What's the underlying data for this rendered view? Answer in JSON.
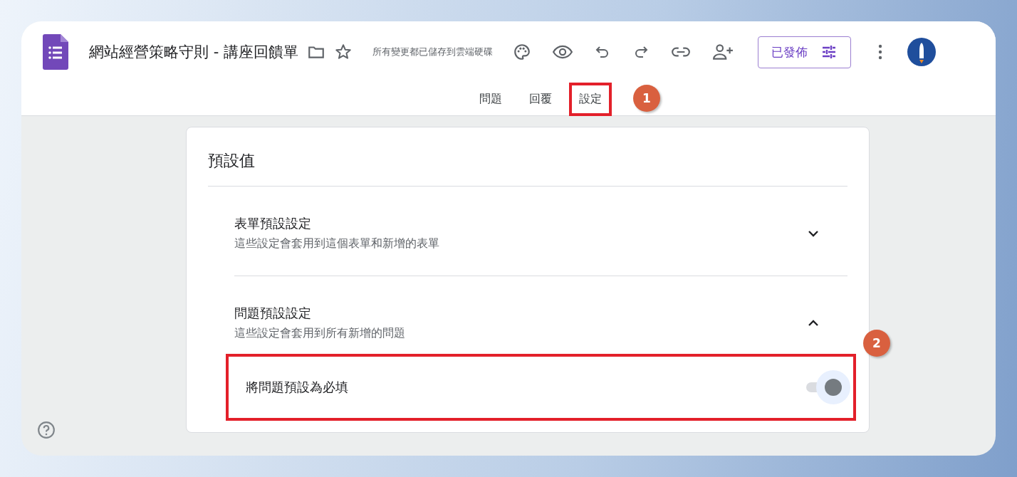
{
  "header": {
    "title": "網站經營策略守則 - 講座回饋單",
    "save_status": "所有變更都已儲存到雲端硬碟",
    "publish_button": "已發佈"
  },
  "tabs": [
    {
      "label": "問題",
      "selected": false
    },
    {
      "label": "回覆",
      "selected": false
    },
    {
      "label": "設定",
      "selected": true,
      "callout": "1"
    }
  ],
  "settings_card": {
    "title": "預設值",
    "sections": [
      {
        "title": "表單預設設定",
        "description": "這些設定會套用到這個表單和新增的表單",
        "expanded": false
      },
      {
        "title": "問題預設設定",
        "description": "這些設定會套用到所有新增的問題",
        "expanded": true,
        "callout": "2",
        "settings": [
          {
            "label": "將問題預設為必填",
            "on": false,
            "highlighted": true
          }
        ]
      }
    ]
  }
}
